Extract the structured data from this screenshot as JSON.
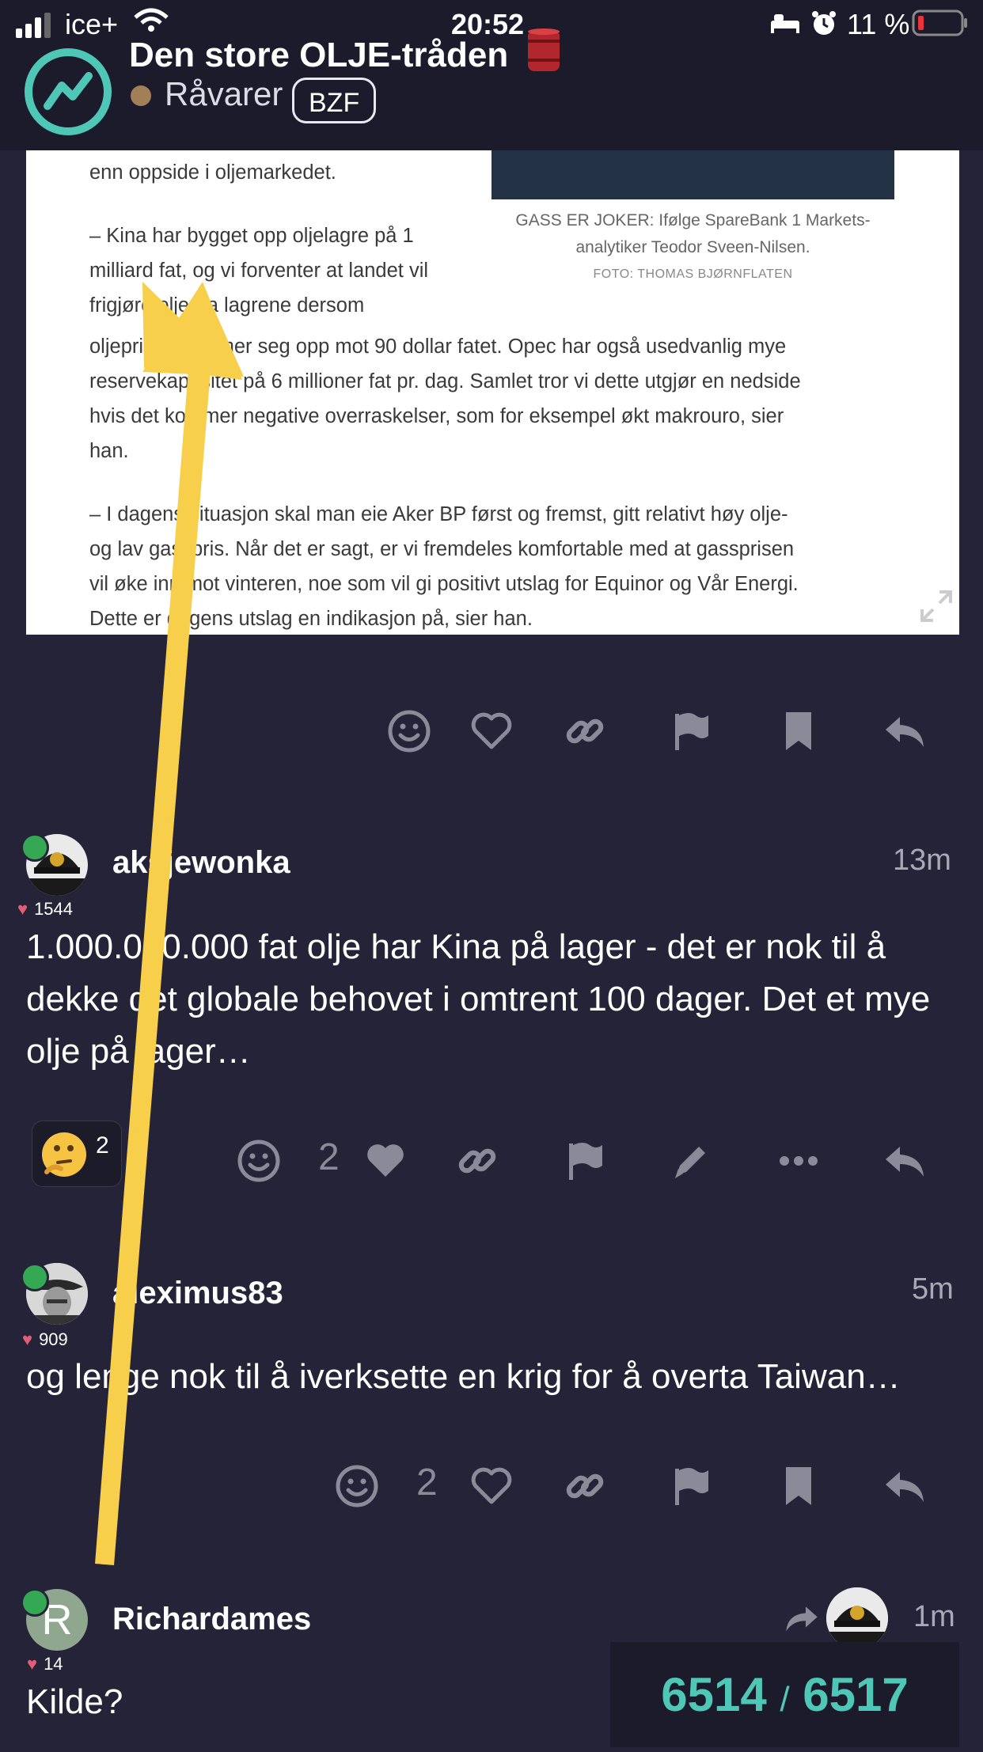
{
  "status_bar": {
    "carrier": "ice+",
    "time": "20:52",
    "battery": "11 %"
  },
  "topic": {
    "title": "Den store OLJE-tråden",
    "category": "Råvarer",
    "tag": "BZF",
    "accent_color": "#4fc7b7",
    "category_color": "#a37f58"
  },
  "article": {
    "lines_col": [
      "enn oppside i oljemarkedet.",
      "– Kina har bygget opp oljelagre på 1",
      "milliard fat, og vi forventer at landet vil",
      "frigjøre olje fra lagrene dersom"
    ],
    "lines_full": [
      "oljeprisen nærmer seg opp mot 90 dollar fatet. Opec har også usedvanlig mye",
      "reservekapasitet på 6 millioner fat pr. dag. Samlet tror vi dette utgjør en nedside",
      "hvis det kommer negative overraskelser, som for eksempel økt makrouro, sier",
      "han.",
      "– I dagens situasjon skal man eie Aker BP først og fremst, gitt relativt høy olje-",
      "og lav gasspris. Når det er sagt, er vi fremdeles komfortable med at gassprisen",
      "vil øke inn mot vinteren, noe som vil gi positivt utslag for Equinor og Vår Energi.",
      "Dette er dagens utslag en indikasjon på, sier han."
    ],
    "caption_line1": "GASS ER JOKER: Ifølge SpareBank 1 Markets-",
    "caption_line2": "analytiker Teodor Sveen-Nilsen.",
    "caption_credit": "FOTO: THOMAS BJØRNFLATEN"
  },
  "posts": [
    {
      "username": "aksjewonka",
      "time": "13m",
      "likes": "1544",
      "text": "1.000.000.000 fat olje har Kina på lager - det er nok til å dekke det globale behovet i omtrent 100 dager. Det et mye olje på lager…",
      "reaction_count": "2",
      "like_count": "2"
    },
    {
      "username": "aleximus83",
      "time": "5m",
      "likes": "909",
      "text": "og lenge nok til å iverksette en krig for å overta Taiwan…",
      "like_count": "2"
    },
    {
      "username": "Richardames",
      "avatar_letter": "R",
      "time": "1m",
      "likes": "14",
      "text": "Kilde?"
    }
  ],
  "progress": {
    "current": "6514",
    "separator": "/",
    "total": "6517"
  }
}
